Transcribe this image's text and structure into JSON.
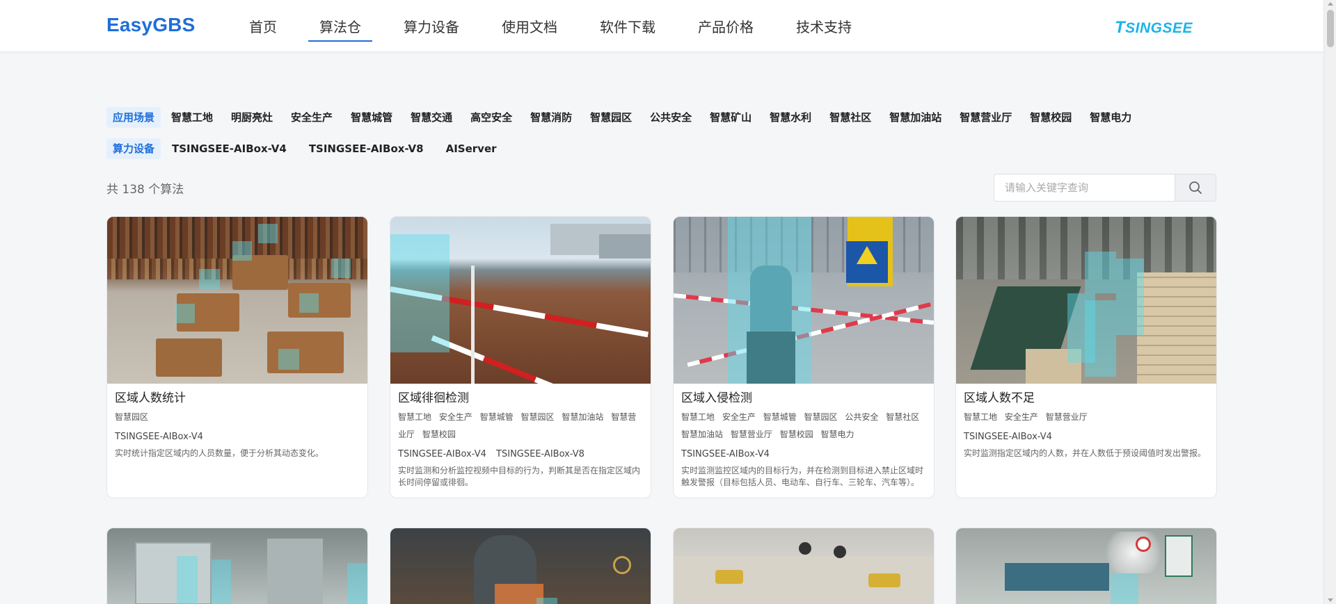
{
  "header": {
    "logo": "EasyGBS",
    "nav": [
      {
        "label": "首页"
      },
      {
        "label": "算法仓"
      },
      {
        "label": "算力设备"
      },
      {
        "label": "使用文档"
      },
      {
        "label": "软件下载"
      },
      {
        "label": "产品价格"
      },
      {
        "label": "技术支持"
      }
    ],
    "brand": {
      "first": "T",
      "rest": "SINGSEE"
    }
  },
  "filters": {
    "scene_label": "应用场景",
    "scenes": [
      "智慧工地",
      "明厨亮灶",
      "安全生产",
      "智慧城管",
      "智慧交通",
      "高空安全",
      "智慧消防",
      "智慧园区",
      "公共安全",
      "智慧矿山",
      "智慧水利",
      "智慧社区",
      "智慧加油站",
      "智慧营业厅",
      "智慧校园",
      "智慧电力"
    ],
    "device_label": "算力设备",
    "devices": [
      "TSINGSEE-AIBox-V4",
      "TSINGSEE-AIBox-V8",
      "AIServer"
    ]
  },
  "total_text": "共 138 个算法",
  "search": {
    "placeholder": "请输入关键字查询"
  },
  "colors": {
    "accent": "#1e6fd9",
    "brand": "#1bb4e8",
    "detection": "#5adceb"
  },
  "cards": [
    {
      "title": "区域人数统计",
      "tags": [
        "智慧园区"
      ],
      "devices": [
        "TSINGSEE-AIBox-V4"
      ],
      "desc": "实时统计指定区域内的人员数量，便于分析其动态变化。"
    },
    {
      "title": "区域徘徊检测",
      "tags": [
        "智慧工地",
        "安全生产",
        "智慧城管",
        "智慧园区",
        "智慧加油站",
        "智慧营业厅",
        "智慧校园"
      ],
      "devices": [
        "TSINGSEE-AIBox-V4",
        "TSINGSEE-AIBox-V8"
      ],
      "desc": "实时监测和分析监控视频中目标的行为，判断其是否在指定区域内长时间停留或徘徊。"
    },
    {
      "title": "区域入侵检测",
      "tags": [
        "智慧工地",
        "安全生产",
        "智慧城管",
        "智慧园区",
        "公共安全",
        "智慧社区",
        "智慧加油站",
        "智慧营业厅",
        "智慧校园",
        "智慧电力"
      ],
      "devices": [
        "TSINGSEE-AIBox-V4"
      ],
      "desc": "实时监测监控区域内的目标行为，并在检测到目标进入禁止区域时触发警报（目标包括人员、电动车、自行车、三轮车、汽车等）。"
    },
    {
      "title": "区域人数不足",
      "tags": [
        "智慧工地",
        "安全生产",
        "智慧营业厅"
      ],
      "devices": [
        "TSINGSEE-AIBox-V4"
      ],
      "desc": "实时监测指定区域内的人数，并在人数低于预设阈值时发出警报。"
    }
  ]
}
